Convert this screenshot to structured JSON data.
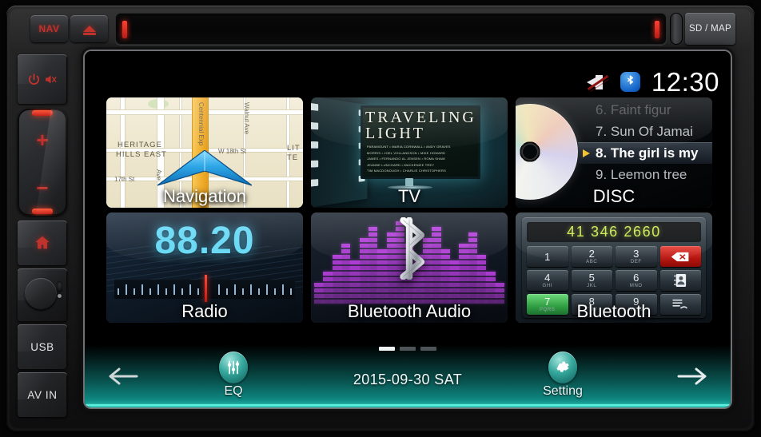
{
  "device": {
    "top_bar": {
      "nav_button": "NAV",
      "eject_button_icon": "eject-icon",
      "disc_slot_name": "disc-slot",
      "sd_map_slot": "SD / MAP"
    },
    "left_panel": {
      "power_mute": {
        "label": "",
        "icons": [
          "power-icon",
          "mute-icon"
        ]
      },
      "volume_up": "+",
      "volume_down": "−",
      "home_icon": "home-icon",
      "knob": "rotary-knob",
      "reset_pinhole": "reset-pinhole",
      "usb_label": "USB",
      "avin_label": "AV IN"
    }
  },
  "screen": {
    "status_bar": {
      "mute_icon": "mute-icon",
      "bluetooth_icon": "bluetooth-icon",
      "clock": "12:30"
    },
    "tiles": [
      {
        "id": "navigation",
        "label": "Navigation",
        "map": {
          "area_label": "HERITAGE\nHILLS EAST",
          "area_label_line1": "HERITAGE",
          "area_label_line2": "HILLS EAST",
          "highway": "Centennial Exp",
          "streets": [
            "Walnut Ave",
            "W 18th St",
            "17th St",
            "Ave"
          ],
          "corner_label_line1": "LIT",
          "corner_label_line2": "TE",
          "marker": "navigation-arrow"
        }
      },
      {
        "id": "tv",
        "label": "TV",
        "poster": {
          "title_line1": "TRAVELING",
          "title_line2": "LIGHT",
          "credits_lines": [
            "PARAMOUNT • MARIA CORNWALL • ANDY GRAVES",
            "MORRIS • JOEL VOLLANDSON • MIKE HOWARD",
            "JAMES • FERNANDO AL JENSEN • ROMA SHAW",
            "JEANNE LUNCHARD • MACKENZIE TREY",
            "TIM MACDONOUGH • CHARLIE CHRISTOPHERS"
          ]
        }
      },
      {
        "id": "disc",
        "label": "DISC",
        "tracks": [
          {
            "text": "6. Faint figur",
            "state": "faded"
          },
          {
            "text": "7. Sun Of Jamai",
            "state": "normal"
          },
          {
            "text": "8. The girl is my",
            "state": "playing"
          },
          {
            "text": "9. Leemon tree",
            "state": "normal"
          }
        ]
      },
      {
        "id": "radio",
        "label": "Radio",
        "frequency": "88.20"
      },
      {
        "id": "bluetooth-audio",
        "label": "Bluetooth Audio"
      },
      {
        "id": "bluetooth-phone",
        "label": "Bluetooth",
        "dial_number": "41 346 2660",
        "keys": [
          {
            "num": "1",
            "sub": ""
          },
          {
            "num": "2",
            "sub": "ABC"
          },
          {
            "num": "3",
            "sub": "DEF"
          },
          {
            "num": "",
            "sub": "",
            "kind": "delete"
          },
          {
            "num": "4",
            "sub": "GHI"
          },
          {
            "num": "5",
            "sub": "JKL"
          },
          {
            "num": "6",
            "sub": "MNO"
          },
          {
            "num": "",
            "sub": "",
            "kind": "contacts"
          },
          {
            "num": "7",
            "sub": "PQRS",
            "kind": "green"
          },
          {
            "num": "8",
            "sub": "TUV"
          },
          {
            "num": "9",
            "sub": "WXYZ"
          },
          {
            "num": "",
            "sub": "",
            "kind": "calllog"
          }
        ]
      }
    ],
    "bottom_bar": {
      "prev_label": "previous-page",
      "next_label": "next-page",
      "eq_label": "EQ",
      "setting_label": "Setting",
      "date": "2015-09-30  SAT",
      "pages": {
        "total": 3,
        "active": 1
      }
    }
  },
  "colors": {
    "accent_teal": "#0f8f88",
    "accent_cyan": "#5ff0de",
    "radio_cyan": "#63d8f5",
    "red_led": "#c0322c",
    "dial_green": "#c9e84a",
    "eq_purple": "#b93fe0",
    "bluetooth_blue": "#1565c8"
  }
}
